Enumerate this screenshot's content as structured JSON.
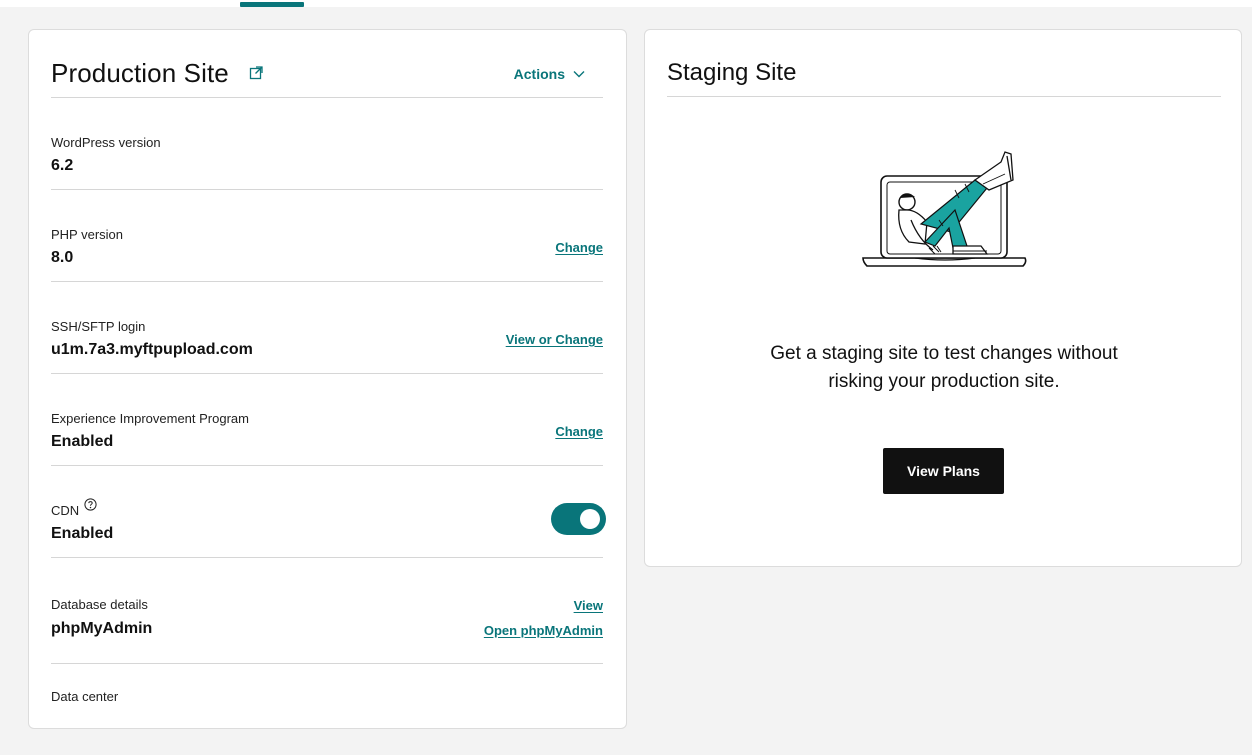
{
  "production": {
    "title": "Production Site",
    "actions_label": "Actions",
    "rows": [
      {
        "label": "WordPress version",
        "value": "6.2"
      },
      {
        "label": "PHP version",
        "value": "8.0",
        "link": "Change"
      },
      {
        "label": "SSH/SFTP login",
        "value": "u1m.7a3.myftpupload.com",
        "link": "View or Change"
      },
      {
        "label": "Experience Improvement Program",
        "value": "Enabled",
        "link": "Change"
      },
      {
        "label": "CDN",
        "value": "Enabled",
        "toggle_on": true
      },
      {
        "label": "Database details",
        "value": "phpMyAdmin",
        "link": "View",
        "link2": "Open phpMyAdmin"
      },
      {
        "label": "Data center"
      }
    ]
  },
  "staging": {
    "title": "Staging Site",
    "description_line1": "Get a staging site to test changes without",
    "description_line2": "risking your production site.",
    "button_label": "View Plans"
  },
  "colors": {
    "accent": "#09757a",
    "primary_button": "#111111",
    "illustration_accent": "#1aa3a0"
  },
  "icons": [
    "external-link-icon",
    "chevron-down-icon",
    "help-circle-icon",
    "staging-illustration"
  ]
}
